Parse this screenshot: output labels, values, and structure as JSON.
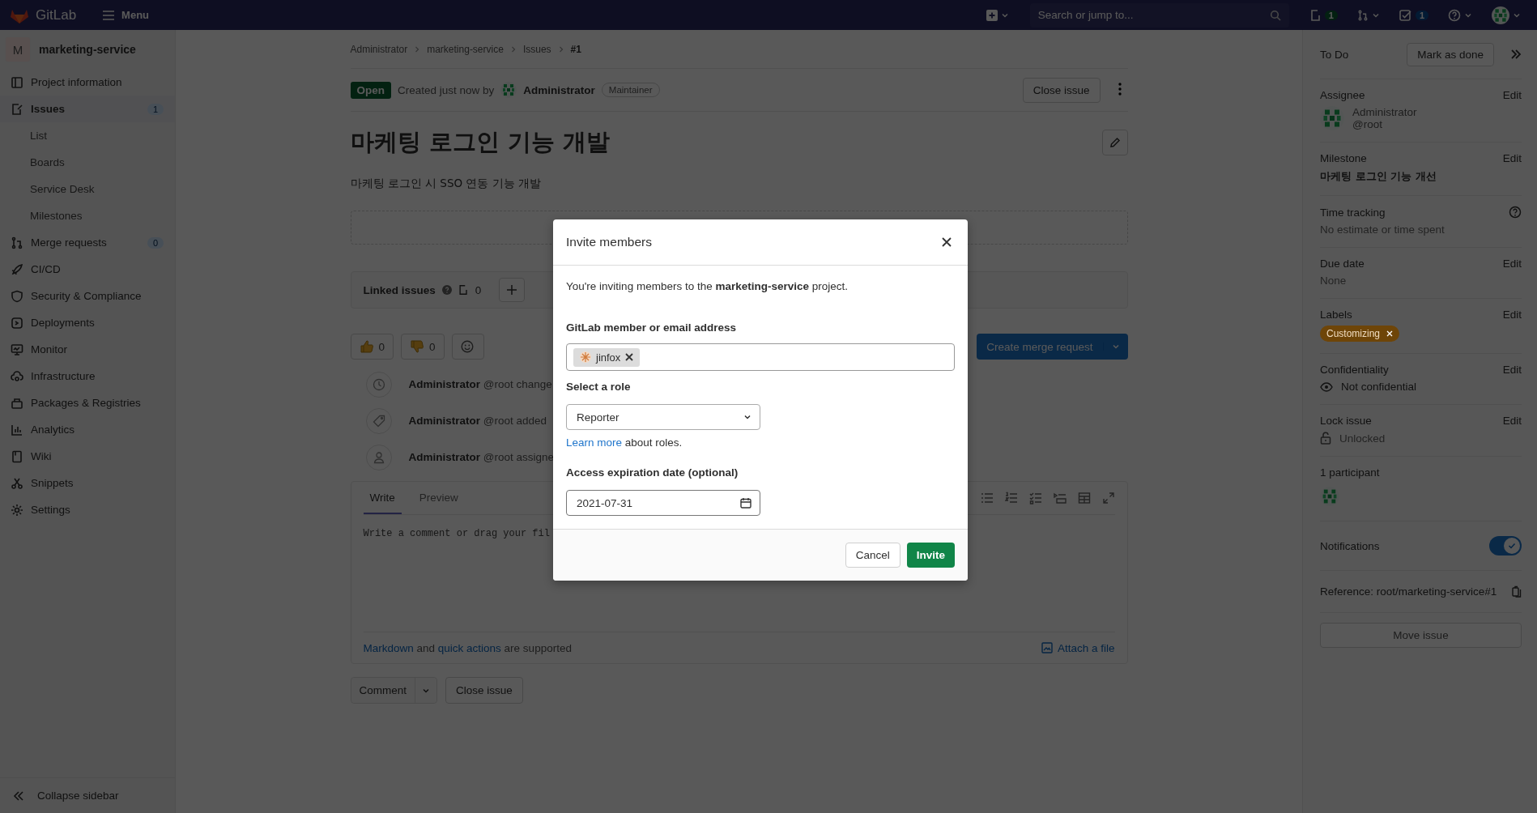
{
  "top_bar": {
    "logo_text": "GitLab",
    "menu_label": "Menu",
    "search": {
      "placeholder": "Search or jump to..."
    },
    "issues_badge": "1",
    "todos_badge": "1"
  },
  "sidebar": {
    "project_initial": "M",
    "project_name": "marketing-service",
    "collapse_label": "Collapse sidebar",
    "items": [
      {
        "label": "Project information",
        "kind": "project",
        "selected": false
      },
      {
        "label": "Issues",
        "kind": "issues",
        "selected": true,
        "count": "1",
        "children": [
          {
            "label": "List",
            "selected": false
          },
          {
            "label": "Boards",
            "selected": false
          },
          {
            "label": "Service Desk",
            "selected": false
          },
          {
            "label": "Milestones",
            "selected": false
          }
        ]
      },
      {
        "label": "Merge requests",
        "kind": "merge",
        "selected": false,
        "count": "0"
      },
      {
        "label": "CI/CD",
        "kind": "rocket",
        "selected": false
      },
      {
        "label": "Security & Compliance",
        "kind": "shield",
        "selected": false
      },
      {
        "label": "Deployments",
        "kind": "deploy",
        "selected": false
      },
      {
        "label": "Monitor",
        "kind": "monitor",
        "selected": false
      },
      {
        "label": "Infrastructure",
        "kind": "cloud",
        "selected": false
      },
      {
        "label": "Packages & Registries",
        "kind": "package",
        "selected": false
      },
      {
        "label": "Analytics",
        "kind": "chart",
        "selected": false
      },
      {
        "label": "Wiki",
        "kind": "book",
        "selected": false
      },
      {
        "label": "Snippets",
        "kind": "scissors",
        "selected": false
      },
      {
        "label": "Settings",
        "kind": "gear",
        "selected": false
      }
    ]
  },
  "breadcrumbs": [
    "Administrator",
    "marketing-service",
    "Issues",
    "#1"
  ],
  "issue": {
    "status": "Open",
    "created_text": "Created just now by",
    "author": "Administrator",
    "author_role": "Maintainer",
    "close_button": "Close issue",
    "title": "마케팅 로그인 기능 개발",
    "description": "마케팅 로그인 시 SSO 연동 기능 개발",
    "linked_issues": {
      "label": "Linked issues",
      "count": "0"
    },
    "reactions": [
      {
        "kind": "thumbs_up",
        "count": "0"
      },
      {
        "kind": "thumbs_down",
        "count": "0"
      },
      {
        "kind": "emoji"
      }
    ],
    "create_mr_button": "Create merge request",
    "activity": [
      {
        "kind": "clock",
        "author": "Administrator",
        "text": "@root change"
      },
      {
        "kind": "tag",
        "author": "Administrator",
        "text": "@root added"
      },
      {
        "kind": "user",
        "author": "Administrator",
        "text": "@root assigne"
      }
    ],
    "editor": {
      "tabs": [
        {
          "label": "Write",
          "selected": true
        },
        {
          "label": "Preview",
          "selected": false
        }
      ],
      "placeholder": "Write a comment or drag your fil",
      "markdown_link": "Markdown",
      "and_text": "and",
      "quick_actions_link": "quick actions",
      "supported_text": "are supported",
      "attach": "Attach a file"
    },
    "comment_button": "Comment",
    "close_issue_button": "Close issue"
  },
  "right_sidebar": {
    "todo_label": "To Do",
    "mark_done_button": "Mark as done",
    "assignee": {
      "heading": "Assignee",
      "edit": "Edit",
      "name": "Administrator",
      "username": "@root"
    },
    "milestone": {
      "heading": "Milestone",
      "edit": "Edit",
      "value": "마케팅 로그인 기능 개선"
    },
    "time_tracking": {
      "heading": "Time tracking",
      "value": "No estimate or time spent"
    },
    "due_date": {
      "heading": "Due date",
      "edit": "Edit",
      "value": "None"
    },
    "labels": {
      "heading": "Labels",
      "edit": "Edit",
      "items": [
        {
          "text": "Customizing",
          "color": "#6e4508"
        }
      ]
    },
    "confidentiality": {
      "heading": "Confidentiality",
      "edit": "Edit",
      "value": "Not confidential"
    },
    "lock": {
      "heading": "Lock issue",
      "edit": "Edit",
      "value": "Unlocked"
    },
    "participants": {
      "heading": "1 participant"
    },
    "notifications": {
      "heading": "Notifications",
      "on": true
    },
    "reference": "Reference: root/marketing-service#1",
    "move_button": "Move issue"
  },
  "modal": {
    "title": "Invite members",
    "intro": "You're inviting members to the **marketing-service** project.",
    "member_label": "GitLab member or email address",
    "tokens": [
      {
        "text": "jinfox"
      }
    ],
    "role_label": "Select a role",
    "role_value": "Reporter",
    "learn_more_link": "Learn more",
    "learn_more_rest": "about roles.",
    "date_label": "Access expiration date (optional)",
    "date_value": "2021-07-31",
    "cancel_button": "Cancel",
    "invite_button": "Invite"
  }
}
